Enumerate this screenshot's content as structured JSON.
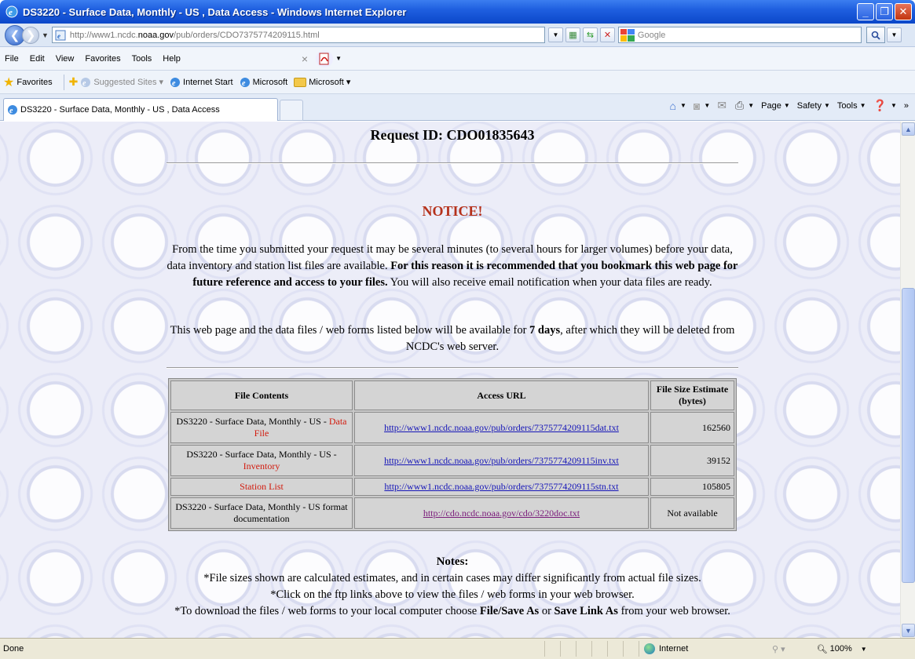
{
  "window": {
    "title": "DS3220 - Surface Data, Monthly - US , Data Access - Windows Internet Explorer"
  },
  "address_bar": {
    "url_prefix": "http://www1.ncdc.",
    "url_domain": "noaa.gov",
    "url_suffix": "/pub/orders/CDO7375774209115.html",
    "search_placeholder": "Google"
  },
  "menu": {
    "items": [
      "File",
      "Edit",
      "View",
      "Favorites",
      "Tools",
      "Help"
    ]
  },
  "favorites_bar": {
    "favorites_label": "Favorites",
    "links": [
      {
        "label": "Suggested Sites ▾",
        "muted": true
      },
      {
        "label": "Internet Start"
      },
      {
        "label": "Microsoft"
      },
      {
        "label": "Microsoft ▾"
      }
    ]
  },
  "tab": {
    "label": "DS3220 - Surface Data, Monthly - US , Data Access"
  },
  "command_bar": {
    "page_label": "Page",
    "safety_label": "Safety",
    "tools_label": "Tools"
  },
  "page": {
    "request_id": "Request ID: CDO01835643",
    "notice": "NOTICE!",
    "para1_a": "From the time you submitted your request it may be several minutes (to several hours for larger volumes) before your data, data inventory and station list files are available. ",
    "para1_bold": "For this reason it is recommended that you bookmark this web page for future reference and access to your files.",
    "para1_b": " You will also receive email notification when your data files are ready.",
    "para2_a": "This web page and the data files / web forms listed below will be available for ",
    "para2_bold": "7 days",
    "para2_b": ", after which they will be deleted from NCDC's web server.",
    "table": {
      "headers": [
        "File Contents",
        "Access URL",
        "File Size Estimate (bytes)"
      ],
      "rows": [
        {
          "content": "DS3220 - Surface Data, Monthly - US -",
          "content_red": "Data File",
          "url": "http://www1.ncdc.noaa.gov/pub/orders/7375774209115dat.txt",
          "size": "162560"
        },
        {
          "content": "DS3220 - Surface Data, Monthly - US -",
          "content_red": "Inventory",
          "url": "http://www1.ncdc.noaa.gov/pub/orders/7375774209115inv.txt",
          "size": "39152"
        },
        {
          "content": "",
          "content_red": "Station List",
          "url": "http://www1.ncdc.noaa.gov/pub/orders/7375774209115stn.txt",
          "size": "105805"
        },
        {
          "content": "DS3220 - Surface Data, Monthly - US format documentation",
          "content_red": "",
          "url": "http://cdo.ncdc.noaa.gov/cdo/3220doc.txt",
          "size": "Not available"
        }
      ]
    },
    "notes_title": "Notes:",
    "note1": "*File sizes shown are calculated estimates, and in certain cases may differ significantly from actual file sizes.",
    "note2": "*Click on the ftp links above to view the files / web forms in your web browser.",
    "note3_a": "*To download the files / web forms to your local computer choose ",
    "note3_b1": "File/Save As",
    "note3_or": " or ",
    "note3_b2": "Save Link As",
    "note3_c": " from your web browser."
  },
  "status_bar": {
    "status": "Done",
    "zone": "Internet",
    "zoom": "100%"
  }
}
